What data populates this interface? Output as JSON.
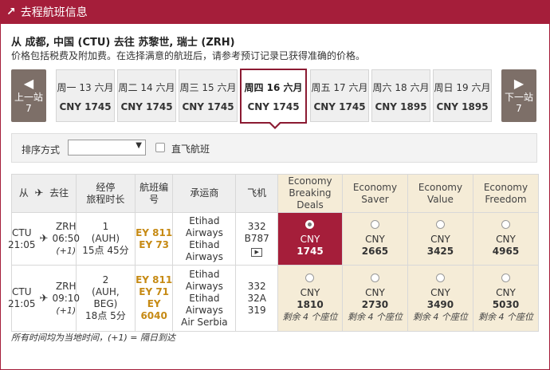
{
  "header": {
    "title": "去程航班信息"
  },
  "route": "从 成都, 中国 (CTU) 去往 苏黎世, 瑞士 (ZRH)",
  "subnote": "价格包括税费及附加费。在选择满意的航班后，请参考预订记录已获得准确的价格。",
  "nav": {
    "prev": {
      "label": "上一站",
      "num": "7"
    },
    "next": {
      "label": "下一站",
      "num": "7"
    }
  },
  "days": [
    {
      "date": "周一 13 六月",
      "price": "CNY 1745"
    },
    {
      "date": "周二 14 六月",
      "price": "CNY 1745"
    },
    {
      "date": "周三 15 六月",
      "price": "CNY 1745"
    },
    {
      "date": "周四 16 六月",
      "price": "CNY 1745"
    },
    {
      "date": "周五 17 六月",
      "price": "CNY 1745"
    },
    {
      "date": "周六 18 六月",
      "price": "CNY 1895"
    },
    {
      "date": "周日 19 六月",
      "price": "CNY 1895"
    }
  ],
  "filter": {
    "sort_label": "排序方式",
    "sort_value": "",
    "direct_label": "直飞航班"
  },
  "table": {
    "headers": {
      "from": "从",
      "to": "去往",
      "stops_line1": "经停",
      "stops_line2": "旅程时长",
      "flight_line1": "航班编",
      "flight_line2": "号",
      "carrier": "承运商",
      "aircraft": "飞机",
      "fare1_l1": "Economy",
      "fare1_l2": "Breaking",
      "fare1_l3": "Deals",
      "fare2_l1": "Economy",
      "fare2_l2": "Saver",
      "fare3_l1": "Economy",
      "fare3_l2": "Value",
      "fare4_l1": "Economy",
      "fare4_l2": "Freedom"
    },
    "rows": [
      {
        "dep_code": "CTU",
        "dep_time": "21:05",
        "arr_code": "ZRH",
        "arr_time": "06:50",
        "arr_plus": "(+1)",
        "stops": "1",
        "via": "(AUH)",
        "duration": "15点 45分",
        "flights": [
          "EY 811",
          "EY 73"
        ],
        "carriers": [
          "Etihad",
          "Airways",
          "Etihad",
          "Airways"
        ],
        "aircraft": [
          "332",
          "B787"
        ],
        "fares": [
          {
            "currency": "CNY",
            "price": "1745",
            "remain": ""
          },
          {
            "currency": "CNY",
            "price": "2665",
            "remain": ""
          },
          {
            "currency": "CNY",
            "price": "3425",
            "remain": ""
          },
          {
            "currency": "CNY",
            "price": "4965",
            "remain": ""
          }
        ]
      },
      {
        "dep_code": "CTU",
        "dep_time": "21:05",
        "arr_code": "ZRH",
        "arr_time": "09:10",
        "arr_plus": "(+1)",
        "stops": "2",
        "via": "(AUH,",
        "via2": "BEG)",
        "duration": "18点 5分",
        "flights": [
          "EY 811",
          "EY 71",
          "EY 6040"
        ],
        "carriers": [
          "Etihad",
          "Airways",
          "Etihad",
          "Airways",
          "Air Serbia"
        ],
        "aircraft": [
          "332",
          "32A",
          "319"
        ],
        "fares": [
          {
            "currency": "CNY",
            "price": "1810",
            "remain": "剩余 4 个座位"
          },
          {
            "currency": "CNY",
            "price": "2730",
            "remain": "剩余 4 个座位"
          },
          {
            "currency": "CNY",
            "price": "3490",
            "remain": "剩余 4 个座位"
          },
          {
            "currency": "CNY",
            "price": "5030",
            "remain": "剩余 4 个座位"
          }
        ]
      }
    ]
  },
  "footnote": "所有时间均为当地时间，(+1) = 隔日到达",
  "colors": {
    "brand": "#a51e3a",
    "fare_bg": "#f5ecd7",
    "flight_no": "#c68a14",
    "nav": "#7d6f68"
  }
}
